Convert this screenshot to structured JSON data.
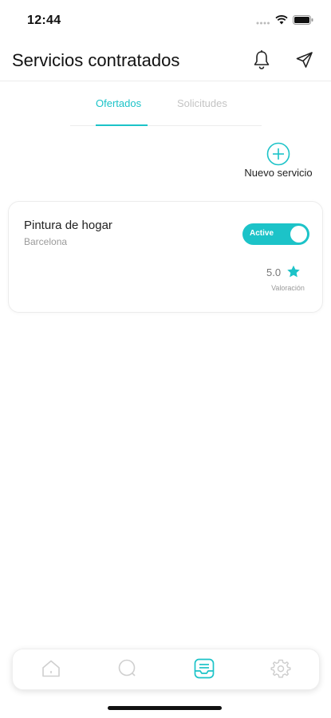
{
  "status_bar": {
    "time": "12:44",
    "icons": [
      "signal-icon",
      "wifi-icon",
      "battery-icon"
    ]
  },
  "header": {
    "title": "Servicios contratados",
    "actions": [
      "bell-icon",
      "send-icon"
    ]
  },
  "tabs": [
    {
      "label": "Ofertados",
      "active": true
    },
    {
      "label": "Solicitudes",
      "active": false
    }
  ],
  "new_service": {
    "label": "Nuevo servicio",
    "icon": "plus-circle-icon"
  },
  "services": [
    {
      "title": "Pintura de hogar",
      "city": "Barcelona",
      "status": "Active",
      "rating": "5.0",
      "rating_label": "Valoración"
    }
  ],
  "bottom_nav": [
    {
      "name": "home",
      "icon": "home-icon",
      "active": false
    },
    {
      "name": "search",
      "icon": "search-icon",
      "active": false
    },
    {
      "name": "services",
      "icon": "inbox-icon",
      "active": true
    },
    {
      "name": "settings",
      "icon": "gear-icon",
      "active": false
    }
  ],
  "colors": {
    "accent": "#1cc3c8",
    "inactive": "#c4c4c4",
    "text": "#222222"
  }
}
